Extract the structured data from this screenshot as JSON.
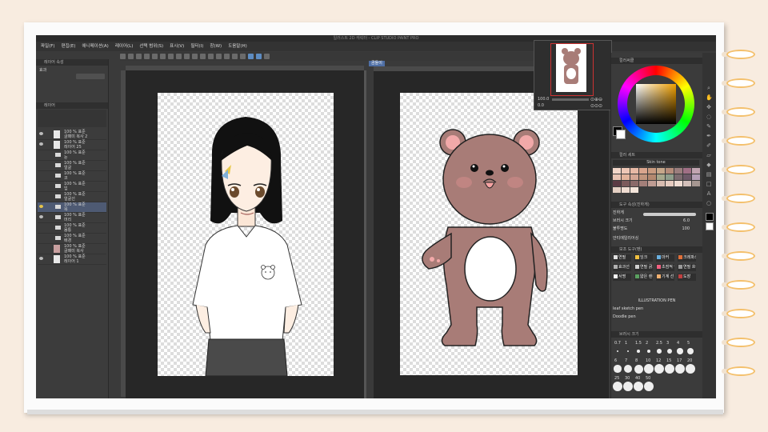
{
  "app": {
    "title": "일러스트 2D 캐릭터 - CLIP STUDIO PAINT PRO"
  },
  "menu": [
    "파일(F)",
    "편집(E)",
    "애니메이션(A)",
    "레이어(L)",
    "선택 범위(S)",
    "표시(V)",
    "필터(I)",
    "창(W)",
    "도움말(H)"
  ],
  "left_panel": {
    "header": "레이어 속성",
    "effect_label": "효과",
    "layers_header": "레이어",
    "layers": [
      {
        "line1": "100 % 표준",
        "line2": "글패미 복사 2",
        "type": "raster",
        "visible": true
      },
      {
        "line1": "100 % 표준",
        "line2": "레이어 25",
        "type": "raster",
        "visible": true
      },
      {
        "line1": "100 % 표준",
        "line2": "눈",
        "type": "folder",
        "visible": true
      },
      {
        "line1": "100 % 표준",
        "line2": "얼굴",
        "type": "folder",
        "visible": true
      },
      {
        "line1": "100 % 표준",
        "line2": "코",
        "type": "folder",
        "visible": true
      },
      {
        "line1": "100 % 표준",
        "line2": "입",
        "type": "folder",
        "visible": true
      },
      {
        "line1": "100 % 표준",
        "line2": "얼굴선",
        "type": "folder",
        "visible": true
      },
      {
        "line1": "100 % 표준",
        "line2": "목",
        "type": "folder",
        "visible": true,
        "selected": true
      },
      {
        "line1": "100 % 표준",
        "line2": "머리",
        "type": "folder",
        "visible": true
      },
      {
        "line1": "100 % 표준",
        "line2": "몸통",
        "type": "folder",
        "visible": true
      },
      {
        "line1": "100 % 표준",
        "line2": "배경",
        "type": "folder",
        "visible": true
      },
      {
        "line1": "100 % 표준",
        "line2": "글패미 복사",
        "type": "bear-thumb",
        "visible": true
      },
      {
        "line1": "100 % 표준",
        "line2": "레이어 1",
        "type": "raster",
        "visible": true
      }
    ]
  },
  "canvas": {
    "tab_label": "곰돌이"
  },
  "navigator": {
    "zoom": "100.0",
    "angle": "0.0"
  },
  "right_panel": {
    "color_wheel_header": "컬러써클",
    "color_set_header": "컬러 세트",
    "color_set_name": "Skin tone",
    "brush_size_header": "도구 속성(진하게)",
    "brush_name": "진하게",
    "brush_size_label": "브러시 크기",
    "brush_size_value": "6.0",
    "opacity_label": "불투명도",
    "opacity_value": "100",
    "stabilization_label": "안티에일리어싱",
    "sub_tool_header": "보조 도구(펜)",
    "sub_tools": [
      "연필",
      "잉크",
      "마커",
      "크레파스",
      "효과선",
      "연필 굵게",
      "초점적 인피",
      "연필 흐림",
      "서명",
      "얇은 렌더",
      "기계 선",
      "도장"
    ],
    "brush_list": [
      "ILLUSTRATION PEN",
      "leaf sketch pen",
      "Doodle pen"
    ],
    "size_palette_header": "브러시 크기",
    "sizes": [
      "0.7",
      "1",
      "1.5",
      "2",
      "2.5",
      "3",
      "4",
      "5",
      "6",
      "7",
      "8",
      "10",
      "12",
      "15",
      "17",
      "20",
      "25",
      "30",
      "40",
      "50"
    ]
  },
  "colors": {
    "main_color": "#000000",
    "sub_color": "#ffffff",
    "skin_swatches": [
      "#f2d6c9",
      "#eec7b6",
      "#e7b9a5",
      "#d9a58d",
      "#c99b80",
      "#c6a78a",
      "#b58c7a",
      "#9b7e7e",
      "#a06f85",
      "#c2a5b1",
      "#e8c3b3",
      "#e2b39b",
      "#d3a694",
      "#c0957d",
      "#b3886f",
      "#a6a88c",
      "#8f9e8c",
      "#7c6b6f",
      "#6d5968",
      "#b6a0b6",
      "#5b3b44",
      "#7c5a5b",
      "#8a6a69",
      "#a37f79",
      "#bf9c93",
      "#d8bcb0",
      "#e6ccc0",
      "#f0ddd3",
      "#d3c0ba",
      "#a69791",
      "#e5d0c4",
      "#efdcd1",
      "#f4e5da"
    ],
    "bear_body": "#a87c77",
    "bear_belly": "#ffffff",
    "bear_ear_inner": "#f2a9a9"
  },
  "icons": [
    "magnifier-icon",
    "hand-icon",
    "move-icon",
    "lasso-icon",
    "eyedropper-icon",
    "pen-icon",
    "brush-icon",
    "eraser-icon",
    "fill-icon",
    "gradient-icon",
    "text-icon",
    "figure-icon"
  ]
}
